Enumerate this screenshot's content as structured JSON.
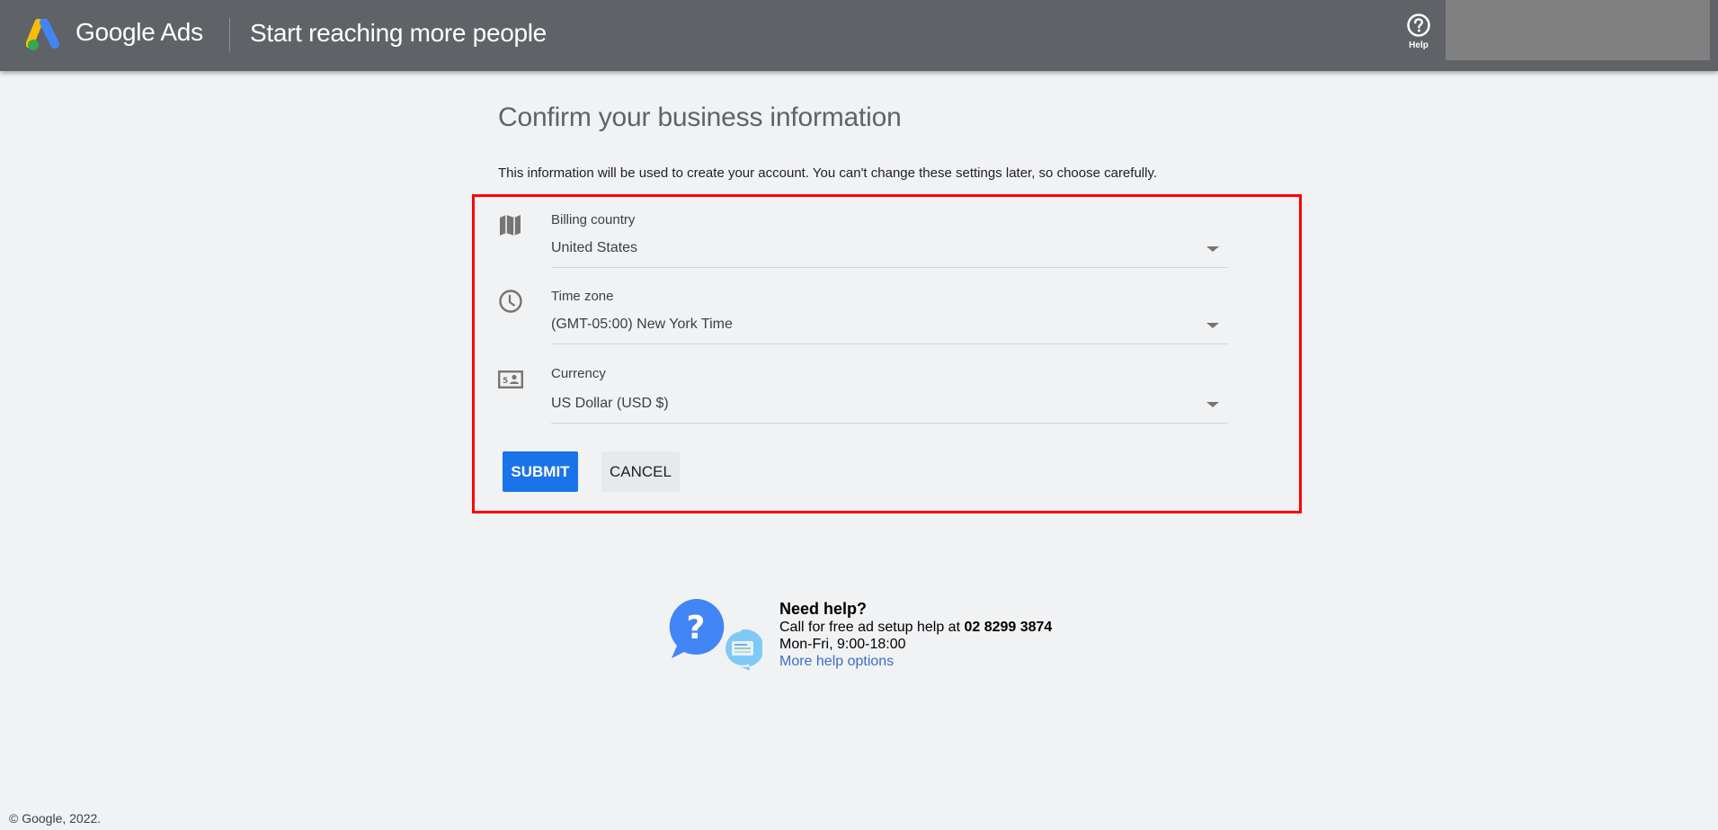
{
  "header": {
    "brand": "Google Ads",
    "subtitle": "Start reaching more people",
    "help_label": "Help",
    "logo_colors": {
      "blue": "#4285f4",
      "yellow": "#fbbc04",
      "green": "#34a853"
    },
    "background": "#5f6368"
  },
  "main": {
    "title": "Confirm your business information",
    "intro": "This information will be used to create your account. You can't change these settings later, so choose carefully.",
    "fields": [
      {
        "label": "Billing country",
        "value": "United States",
        "icon": "map-icon"
      },
      {
        "label": "Time zone",
        "value": "(GMT-05:00) New York Time",
        "icon": "clock-icon"
      },
      {
        "label": "Currency",
        "value": "US Dollar (USD $)",
        "icon": "currency-icon"
      }
    ],
    "submit_label": "SUBMIT",
    "cancel_label": "CANCEL",
    "accent_color": "#1a73e8",
    "highlight_color": "#ff0000"
  },
  "help": {
    "title": "Need help?",
    "call_text": "Call for free ad setup help at ",
    "phone": "02 8299 3874",
    "hours": "Mon-Fri, 9:00-18:00",
    "more_link": "More help options"
  },
  "footer": {
    "copyright": "© Google, 2022."
  }
}
